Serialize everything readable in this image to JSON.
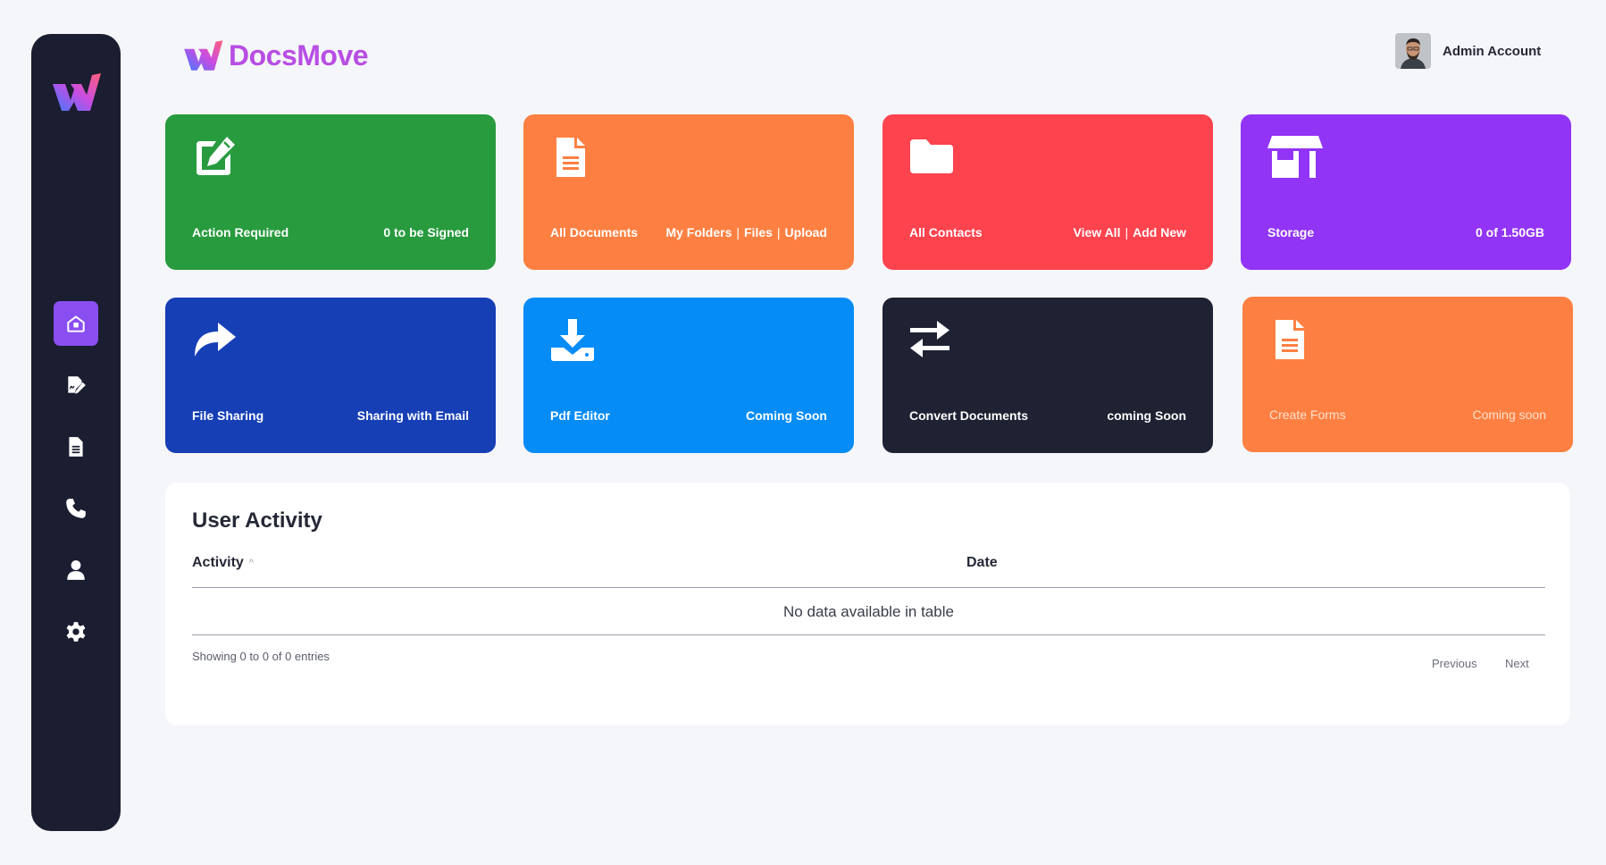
{
  "brand": {
    "name": "DocsMove"
  },
  "account": {
    "name": "Admin Account"
  },
  "sidebar": {
    "items": [
      {
        "icon": "home-icon",
        "active": true
      },
      {
        "icon": "signature-icon",
        "active": false
      },
      {
        "icon": "document-icon",
        "active": false
      },
      {
        "icon": "phone-icon",
        "active": false
      },
      {
        "icon": "user-icon",
        "active": false
      },
      {
        "icon": "gear-icon",
        "active": false
      }
    ]
  },
  "cards": [
    {
      "left": "Action Required",
      "right": [
        "0 to be Signed"
      ],
      "color": "#289b3e",
      "icon": "edit-icon"
    },
    {
      "left": "All Documents",
      "right": [
        "My Folders",
        "Files",
        "Upload"
      ],
      "color": "#fd8042",
      "icon": "file-icon"
    },
    {
      "left": "All Contacts",
      "right": [
        "View All",
        "Add New"
      ],
      "color": "#fd434e",
      "icon": "folder-icon"
    },
    {
      "left": "Storage",
      "right": [
        "0 of 1.50GB"
      ],
      "color": "#9234f5",
      "icon": "store-icon"
    },
    {
      "left": "File Sharing",
      "right": [
        "Sharing with Email"
      ],
      "color": "#163fb6",
      "icon": "share-icon"
    },
    {
      "left": "Pdf Editor",
      "right": [
        "Coming Soon"
      ],
      "color": "#058cf6",
      "icon": "download-icon"
    },
    {
      "left": "Convert Documents",
      "right": [
        "coming Soon"
      ],
      "color": "#1e2233",
      "icon": "exchange-icon"
    },
    {
      "left": "Create Forms",
      "right": [
        "Coming soon"
      ],
      "color": "#fd8042",
      "icon": "file-icon"
    }
  ],
  "activity": {
    "title": "User Activity",
    "columns": [
      "Activity",
      "Date"
    ],
    "empty": "No data available in table",
    "info": "Showing 0 to 0 of 0 entries",
    "prev": "Previous",
    "next": "Next"
  }
}
